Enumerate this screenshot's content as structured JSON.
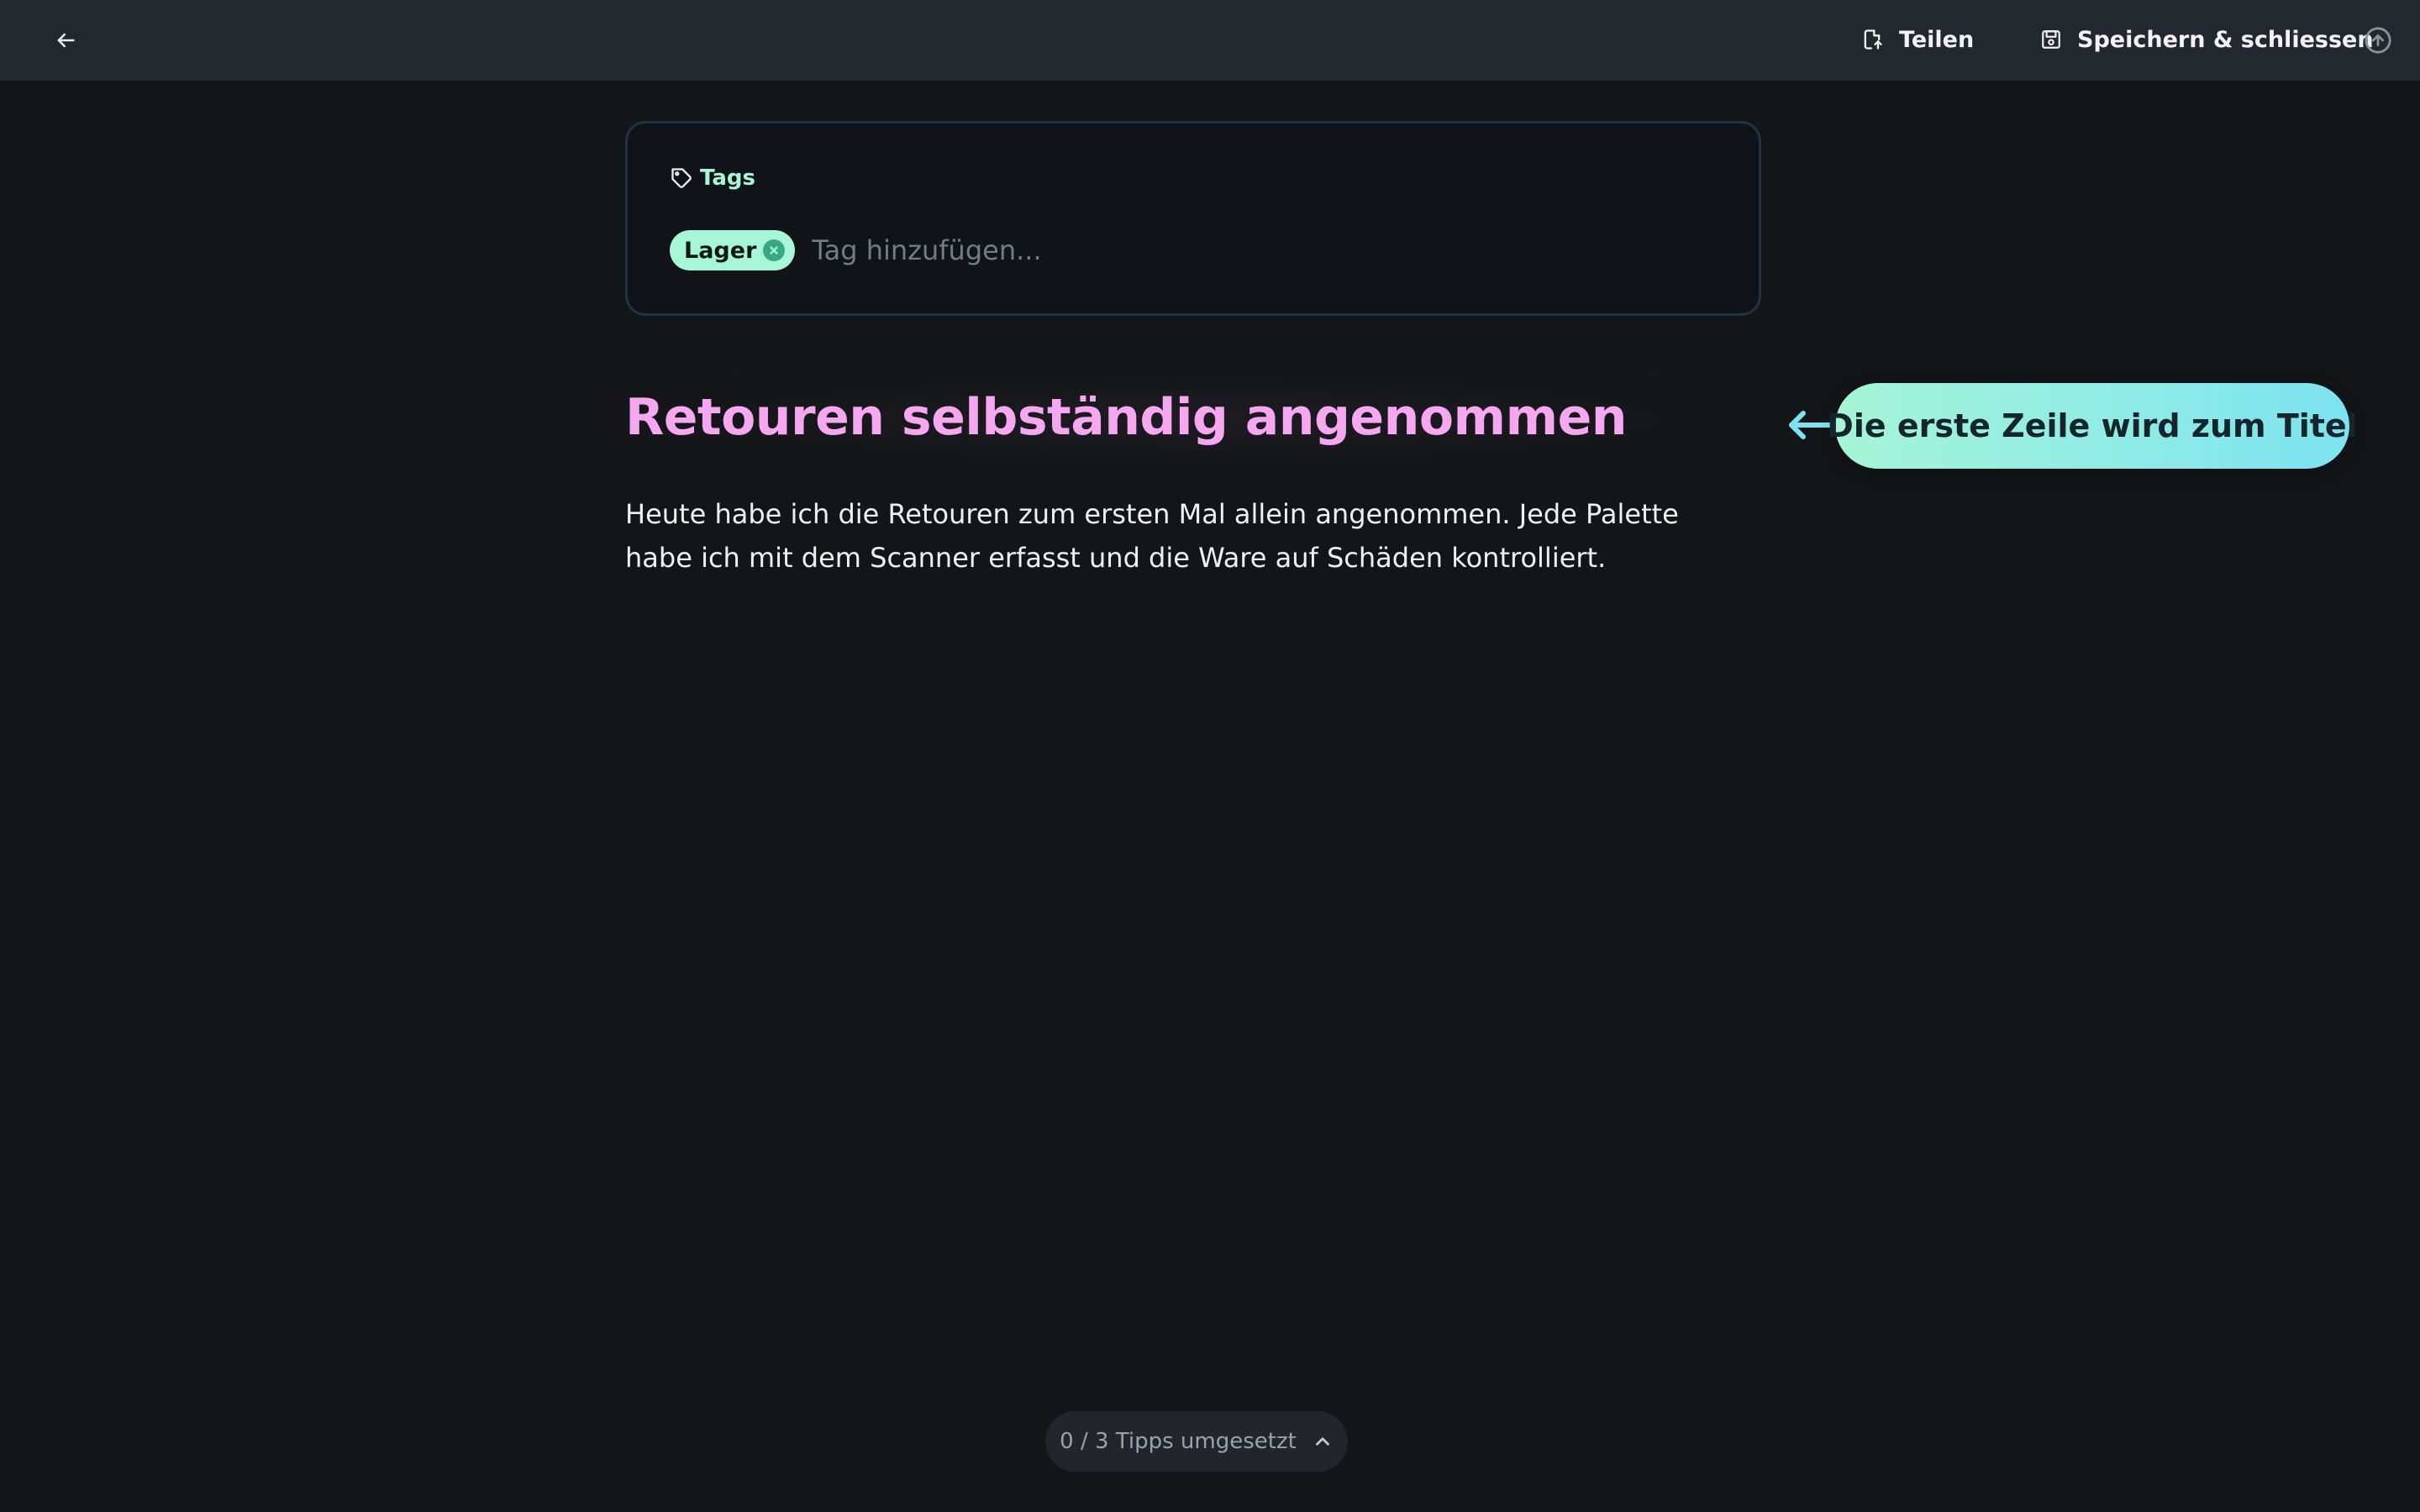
{
  "topbar": {
    "back_icon": "arrow-left-icon",
    "share_label": "Teilen",
    "share_icon": "share-document-icon",
    "save_label": "Speichern & schliessen",
    "save_icon": "save-icon",
    "upload_icon": "upload-circle-icon"
  },
  "tags": {
    "label": "Tags",
    "label_icon": "tag-icon",
    "items": [
      {
        "label": "Lager"
      }
    ],
    "input_placeholder": "Tag hinzufügen..."
  },
  "note": {
    "title": "Retouren selbständig angenommen",
    "body": "Heute habe ich die Retouren zum ersten Mal allein angenommen. Jede Palette habe ich mit dem Scanner erfasst und die Ware auf Schäden kontrolliert."
  },
  "hint": {
    "text": "Die erste Zeile wird zum Titel",
    "arrow_icon": "arrow-left-icon"
  },
  "tips": {
    "progress_text": "0 / 3 Tipps umgesetzt",
    "toggle_icon": "chevron-up-icon"
  },
  "colors": {
    "background": "#131619",
    "topbar": "#23272e",
    "accent_mint": "#a8f6d8",
    "accent_cyan": "#7de3f0",
    "title_pink": "#f5a8f0"
  }
}
